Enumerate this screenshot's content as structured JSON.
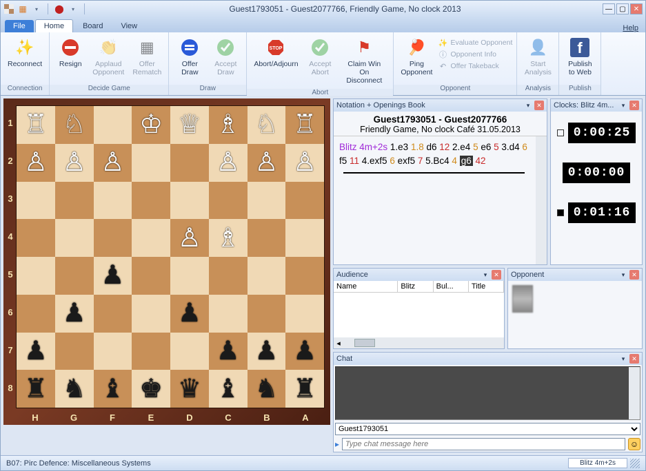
{
  "window_title": "Guest1793051 - Guest2077766, Friendly Game, No clock 2013",
  "file_tab": "File",
  "tabs": [
    "Home",
    "Board",
    "View"
  ],
  "active_tab": "Home",
  "help_label": "Help",
  "ribbon": {
    "connection": {
      "label": "Connection",
      "reconnect": "Reconnect"
    },
    "decide": {
      "label": "Decide Game",
      "resign": "Resign",
      "applaud": "Applaud\nOpponent",
      "rematch": "Offer\nRematch"
    },
    "draw": {
      "label": "Draw",
      "offer": "Offer\nDraw",
      "accept": "Accept\nDraw"
    },
    "abort": {
      "label": "Abort",
      "abort": "Abort/Adjourn",
      "accept": "Accept\nAbort",
      "claim": "Claim Win On\nDisconnect"
    },
    "opponent": {
      "label": "Opponent",
      "ping": "Ping\nOpponent",
      "evaluate": "Evaluate Opponent",
      "info": "Opponent Info",
      "takeback": "Offer Takeback"
    },
    "analysis": {
      "label": "Analysis",
      "start": "Start\nAnalysis"
    },
    "publish": {
      "label": "Publish",
      "web": "Publish\nto Web"
    }
  },
  "notation_panel": {
    "title": "Notation + Openings Book",
    "players": "Guest1793051 - Guest2077766",
    "info": "Friendly Game, No clock Café 31.05.2013",
    "moves": [
      {
        "t": "tc",
        "v": "Blitz 4m+2s"
      },
      {
        "t": "n",
        "v": " 1.e3 "
      },
      {
        "t": "wm",
        "v": "1.8"
      },
      {
        "t": "n",
        "v": " d6 "
      },
      {
        "t": "bt",
        "v": "12"
      },
      {
        "t": "n",
        "v": " 2.e4 "
      },
      {
        "t": "wm",
        "v": "5"
      },
      {
        "t": "n",
        "v": " e6 "
      },
      {
        "t": "bt",
        "v": "5"
      },
      {
        "t": "n",
        "v": " 3.d4 "
      },
      {
        "t": "wm",
        "v": "6"
      },
      {
        "t": "n",
        "v": " f5 "
      },
      {
        "t": "bt",
        "v": "11"
      },
      {
        "t": "n",
        "v": " 4.exf5 "
      },
      {
        "t": "wm",
        "v": "6"
      },
      {
        "t": "n",
        "v": " exf5 "
      },
      {
        "t": "bt",
        "v": "7"
      },
      {
        "t": "n",
        "v": " 5.Bc4 "
      },
      {
        "t": "wm",
        "v": "4"
      },
      {
        "t": "n",
        "v": " "
      },
      {
        "t": "hl",
        "v": "g6"
      },
      {
        "t": "n",
        "v": " "
      },
      {
        "t": "bt",
        "v": "42"
      }
    ]
  },
  "clocks_panel": {
    "title": "Clocks: Blitz 4m...",
    "white": "0:00:25",
    "mid": "0:00:00",
    "black": "0:01:16"
  },
  "audience_panel": {
    "title": "Audience",
    "cols": [
      "Name",
      "Blitz",
      "Bul...",
      "Title"
    ]
  },
  "opponent_panel": {
    "title": "Opponent"
  },
  "chat_panel": {
    "title": "Chat",
    "recipient": "Guest1793051",
    "placeholder": "Type chat message here"
  },
  "board": {
    "ranks": [
      "1",
      "2",
      "3",
      "4",
      "5",
      "6",
      "7",
      "8"
    ],
    "files": [
      "H",
      "G",
      "F",
      "E",
      "D",
      "C",
      "B",
      "A"
    ],
    "pieces": {
      "h1": "♖",
      "g1": "♘",
      "e1": "♔",
      "d1": "♕",
      "c1": "♗",
      "b1": "♘",
      "a1": "♖",
      "h2": "♙",
      "g2": "♙",
      "f2": "♙",
      "c2": "♙",
      "b2": "♙",
      "a2": "♙",
      "d4": "♙",
      "c4": "♗",
      "f5": "♟",
      "g6": "♟",
      "d6": "♟",
      "h7": "♟",
      "c7": "♟",
      "b7": "♟",
      "a7": "♟",
      "h8": "♜",
      "g8": "♞",
      "f8": "♝",
      "e8": "♚",
      "d8": "♛",
      "c8": "♝",
      "b8": "♞",
      "a8": "♜"
    }
  },
  "statusbar": {
    "opening": "B07: Pirc Defence: Miscellaneous Systems",
    "timecontrol": "Blitz 4m+2s"
  }
}
